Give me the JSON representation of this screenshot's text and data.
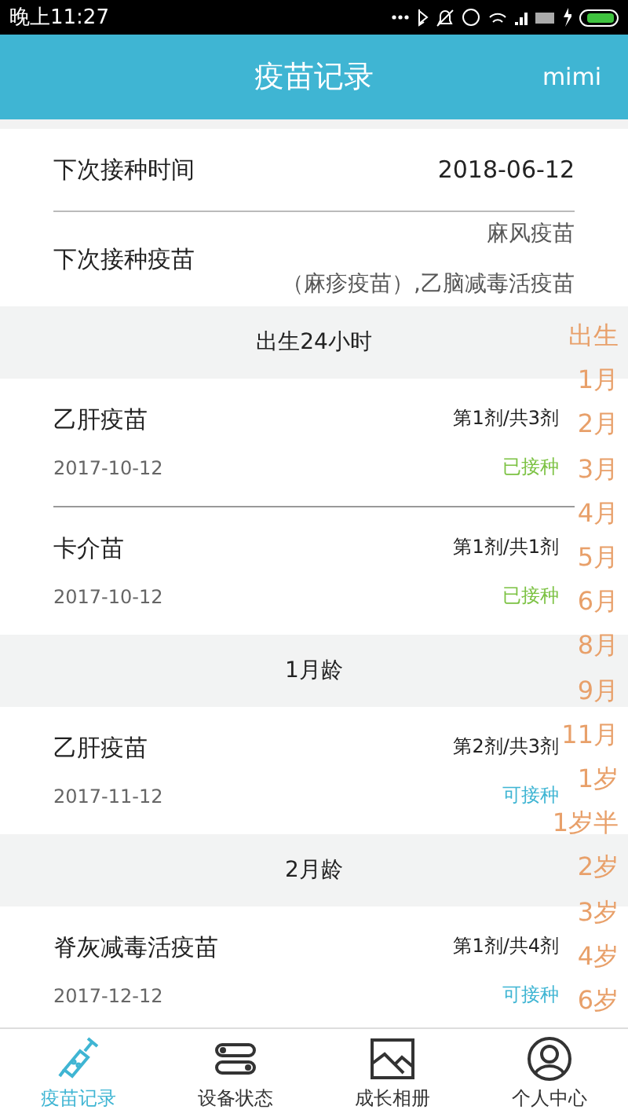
{
  "status_bar": {
    "time": "晚上11:27"
  },
  "header": {
    "title": "疫苗记录",
    "user": "mimi"
  },
  "next": {
    "date_label": "下次接种时间",
    "date": "2018-06-12",
    "vaccine_label": "下次接种疫苗",
    "vaccine_lines": [
      "麻风疫苗",
      "（麻疹疫苗）,乙脑减毒活疫苗"
    ]
  },
  "sections": [
    {
      "title": "出生24小时",
      "items": [
        {
          "name": "乙肝疫苗",
          "date": "2017-10-12",
          "dose": "第1剂/共3剂",
          "status": "已接种",
          "kind": "done"
        },
        {
          "name": "卡介苗",
          "date": "2017-10-12",
          "dose": "第1剂/共1剂",
          "status": "已接种",
          "kind": "done"
        }
      ]
    },
    {
      "title": "1月龄",
      "items": [
        {
          "name": "乙肝疫苗",
          "date": "2017-11-12",
          "dose": "第2剂/共3剂",
          "status": "可接种",
          "kind": "available"
        }
      ]
    },
    {
      "title": "2月龄",
      "items": [
        {
          "name": "脊灰减毒活疫苗",
          "date": "2017-12-12",
          "dose": "第1剂/共4剂",
          "status": "可接种",
          "kind": "available"
        }
      ]
    }
  ],
  "age_index": [
    "出生",
    "1月",
    "2月",
    "3月",
    "4月",
    "5月",
    "6月",
    "8月",
    "9月",
    "11月",
    "1岁",
    "1岁半",
    "2岁",
    "3岁",
    "4岁",
    "6岁"
  ],
  "tabs": [
    {
      "label": "疫苗记录",
      "selected": true
    },
    {
      "label": "设备状态",
      "selected": false
    },
    {
      "label": "成长相册",
      "selected": false
    },
    {
      "label": "个人中心",
      "selected": false
    }
  ]
}
